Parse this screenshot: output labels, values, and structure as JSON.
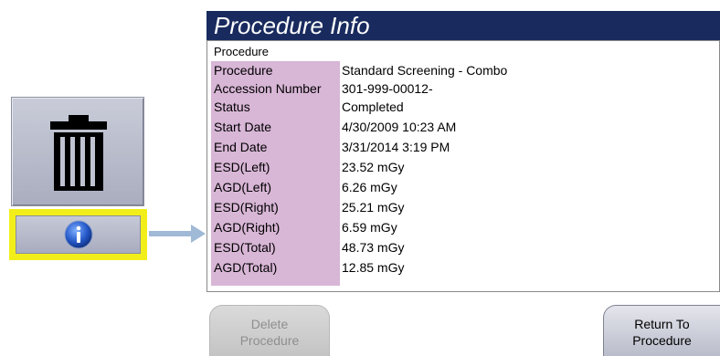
{
  "panel": {
    "title": "Procedure Info",
    "section_label": "Procedure",
    "rows": [
      {
        "label": "Procedure",
        "value": "Standard Screening - Combo"
      },
      {
        "label": "Accession Number",
        "value": "301-999-00012-"
      },
      {
        "label": "Status",
        "value": "Completed"
      },
      {
        "label": "Start Date",
        "value": "4/30/2009 10:23 AM"
      },
      {
        "label": "End Date",
        "value": "3/31/2014 3:19 PM"
      },
      {
        "label": "ESD(Left)",
        "value": "23.52 mGy"
      },
      {
        "label": "AGD(Left)",
        "value": "6.26 mGy"
      },
      {
        "label": "ESD(Right)",
        "value": "25.21 mGy"
      },
      {
        "label": "AGD(Right)",
        "value": "6.59 mGy"
      },
      {
        "label": "ESD(Total)",
        "value": "48.73 mGy"
      },
      {
        "label": "AGD(Total)",
        "value": "12.85 mGy"
      }
    ]
  },
  "buttons": {
    "delete_line1": "Delete",
    "delete_line2": "Procedure",
    "return_line1": "Return To",
    "return_line2": "Procedure"
  },
  "icons": {
    "trash": "trash-icon",
    "info": "info-icon",
    "arrow": "arrow-right-icon"
  },
  "colors": {
    "title_bar": "#192b5e",
    "label_column": "#d8b6d6",
    "highlight": "#f2ee1a"
  }
}
